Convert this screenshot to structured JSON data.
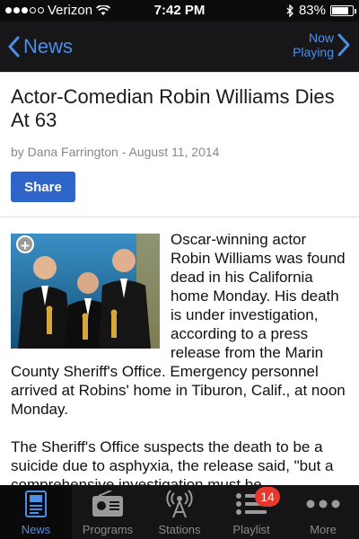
{
  "status": {
    "carrier": "Verizon",
    "time": "7:42 PM",
    "battery_text": "83%",
    "battery_level": 0.83,
    "signal_bars_filled": 3,
    "signal_bars_total": 5
  },
  "nav": {
    "back_label": "News",
    "now_playing_line1": "Now",
    "now_playing_line2": "Playing"
  },
  "article": {
    "headline": "Actor-Comedian Robin Williams Dies At 63",
    "byline": "by Dana Farrington - August 11, 2014",
    "share_label": "Share",
    "photo_badge": "+",
    "paragraph1": "Oscar-winning actor Robin Williams was found dead in his California home Monday. His death is under investigation, according to a press release from the Marin County Sheriff's Office. Emergency personnel arrived at Robins' home in Tiburon, Calif., at noon Monday.",
    "paragraph2": "The Sheriff's Office suspects the death to be a suicide due to asphyxia, the release said, \"but a comprehensive investigation must be"
  },
  "tabs": [
    {
      "label": "News",
      "icon": "news-icon",
      "active": true
    },
    {
      "label": "Programs",
      "icon": "radio-icon",
      "active": false
    },
    {
      "label": "Stations",
      "icon": "broadcast-icon",
      "active": false
    },
    {
      "label": "Playlist",
      "icon": "playlist-icon",
      "active": false,
      "badge": "14"
    },
    {
      "label": "More",
      "icon": "more-icon",
      "active": false
    }
  ],
  "colors": {
    "accent": "#4c8fe6",
    "share_button": "#2f64c9",
    "badge": "#e8392e"
  }
}
